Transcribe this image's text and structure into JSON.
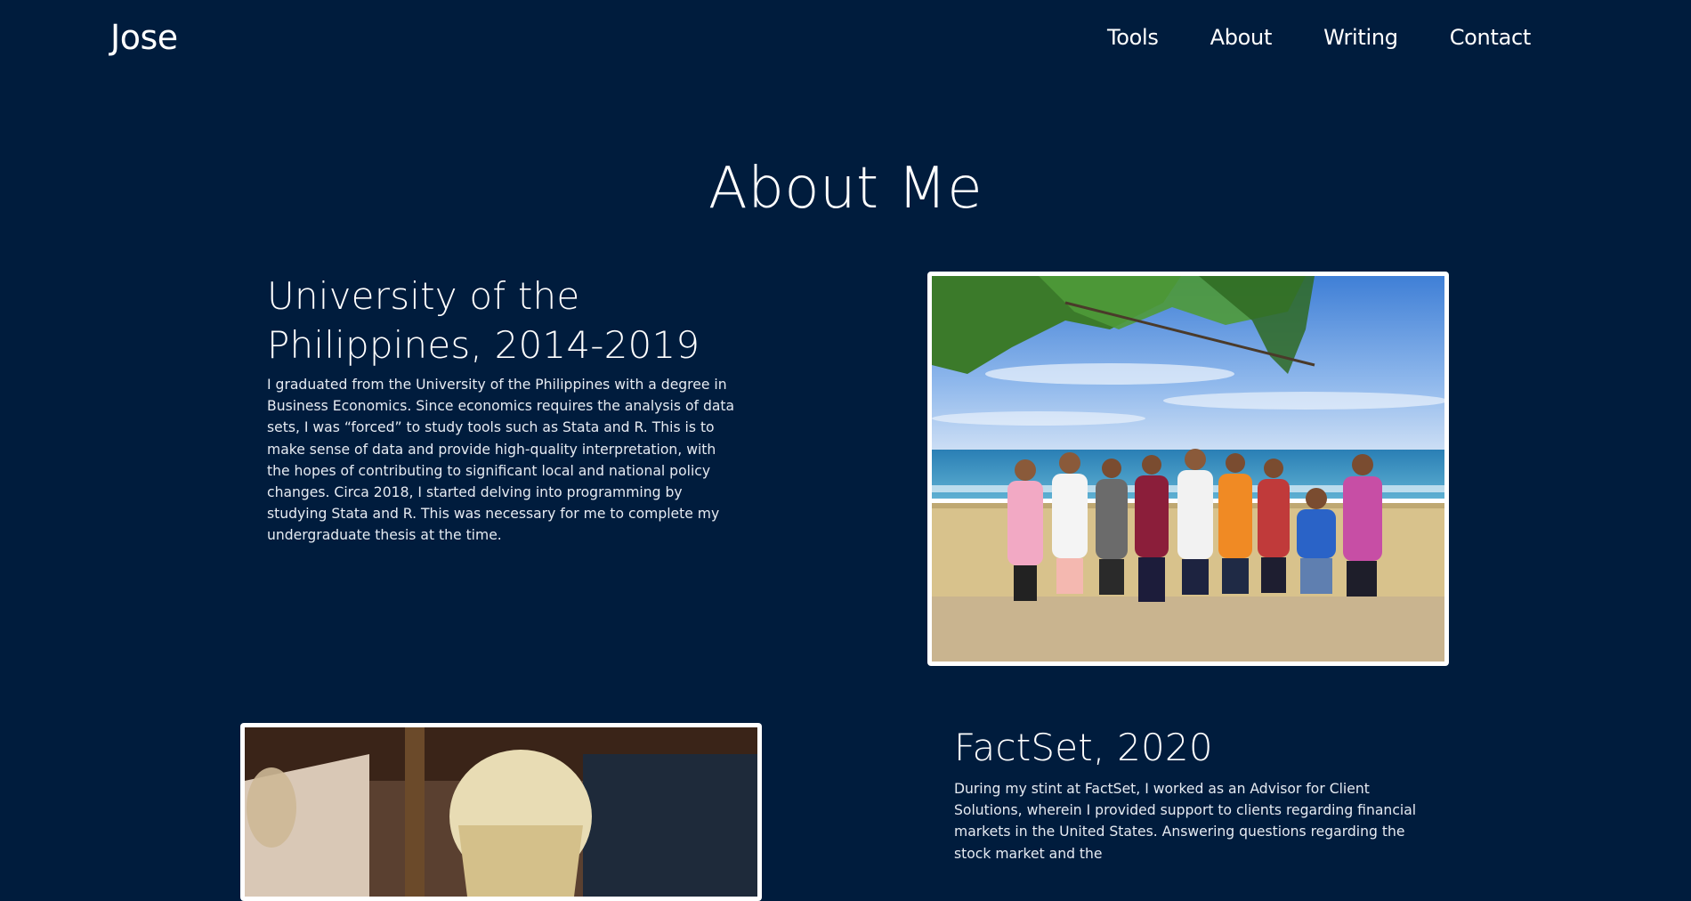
{
  "nav": {
    "brand": "Jose",
    "links": [
      "Tools",
      "About",
      "Writing",
      "Contact"
    ]
  },
  "page": {
    "title": "About Me"
  },
  "sections": [
    {
      "title": "University of the Philippines, 2014-2019",
      "text": "I graduated from the University of the Philippines with a degree in Business Economics. Since economics requires the analysis of data sets, I was “forced” to study tools such as Stata and R. This is to make sense of data and provide high-quality interpretation, with the hopes of contributing to significant local and national policy changes. Circa 2018, I started delving into programming by studying Stata and R. This was necessary for me to complete my undergraduate thesis at the time."
    },
    {
      "title": "FactSet, 2020",
      "text": "During my stint at FactSet, I worked as an Advisor for Client Solutions, wherein I provided support to clients regarding financial markets in the United States. Answering questions regarding the stock market and the"
    }
  ],
  "colors": {
    "background": "#001c3d",
    "text": "#ffffff",
    "frame": "#ffffff"
  }
}
